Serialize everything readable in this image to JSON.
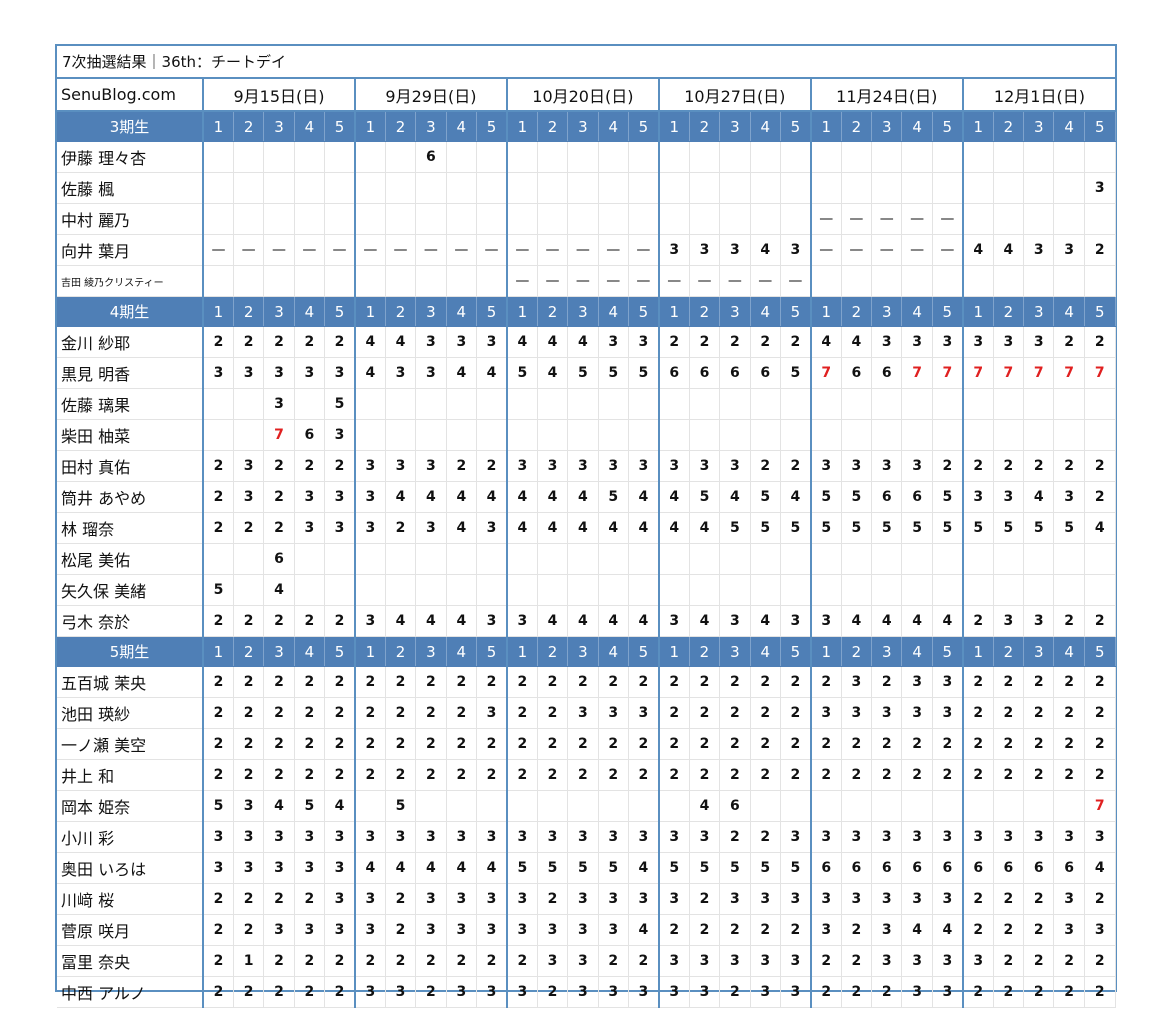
{
  "title": "7次抽選結果｜36th：チートデイ",
  "site_label": "SenuBlog.com",
  "dates": [
    "9月15日(日)",
    "9月29日(日)",
    "10月20日(日)",
    "10月27日(日)",
    "11月24日(日)",
    "12月1日(日)"
  ],
  "part_labels": [
    "1",
    "2",
    "3",
    "4",
    "5"
  ],
  "colors": {
    "header_blue": "#4f7fb6",
    "border_blue": "#5a8fc0",
    "highlight_red": "#e02020"
  },
  "groups": [
    {
      "name": "3期生",
      "members": [
        {
          "name": "伊藤 理々杏",
          "v": [
            "",
            "",
            "",
            "",
            "",
            "",
            "",
            "6",
            "",
            "",
            "",
            "",
            "",
            "",
            "",
            "",
            "",
            "",
            "",
            "",
            "",
            "",
            "",
            "",
            "",
            "",
            "",
            "",
            "",
            ""
          ]
        },
        {
          "name": "佐藤 楓",
          "v": [
            "",
            "",
            "",
            "",
            "",
            "",
            "",
            "",
            "",
            "",
            "",
            "",
            "",
            "",
            "",
            "",
            "",
            "",
            "",
            "",
            "",
            "",
            "",
            "",
            "",
            "",
            "",
            "",
            "",
            "3"
          ]
        },
        {
          "name": "中村 麗乃",
          "v": [
            "",
            "",
            "",
            "",
            "",
            "",
            "",
            "",
            "",
            "",
            "",
            "",
            "",
            "",
            "",
            "",
            "",
            "",
            "",
            "",
            "—",
            "—",
            "—",
            "—",
            "—",
            "",
            "",
            "",
            "",
            ""
          ]
        },
        {
          "name": "向井 葉月",
          "v": [
            "—",
            "—",
            "—",
            "—",
            "—",
            "—",
            "—",
            "—",
            "—",
            "—",
            "—",
            "—",
            "—",
            "—",
            "—",
            "3",
            "3",
            "3",
            "4",
            "3",
            "—",
            "—",
            "—",
            "—",
            "—",
            "4",
            "4",
            "3",
            "3",
            "2"
          ]
        },
        {
          "name": "吉田 綾乃クリスティー",
          "small": true,
          "v": [
            "",
            "",
            "",
            "",
            "",
            "",
            "",
            "",
            "",
            "",
            "—",
            "—",
            "—",
            "—",
            "—",
            "—",
            "—",
            "—",
            "—",
            "—",
            "",
            "",
            "",
            "",
            "",
            "",
            "",
            "",
            "",
            ""
          ]
        }
      ]
    },
    {
      "name": "4期生",
      "members": [
        {
          "name": "金川 紗耶",
          "v": [
            "2",
            "2",
            "2",
            "2",
            "2",
            "4",
            "4",
            "3",
            "3",
            "3",
            "4",
            "4",
            "4",
            "3",
            "3",
            "2",
            "2",
            "2",
            "2",
            "2",
            "4",
            "4",
            "3",
            "3",
            "3",
            "3",
            "3",
            "3",
            "2",
            "2"
          ]
        },
        {
          "name": "黒見 明香",
          "v": [
            "3",
            "3",
            "3",
            "3",
            "3",
            "4",
            "3",
            "3",
            "4",
            "4",
            "5",
            "4",
            "5",
            "5",
            "5",
            "6",
            "6",
            "6",
            "6",
            "5",
            "7r",
            "6",
            "6",
            "7r",
            "7r",
            "7r",
            "7r",
            "7r",
            "7r",
            "7r"
          ]
        },
        {
          "name": "佐藤 璃果",
          "v": [
            "",
            "",
            "3",
            "",
            "5",
            "",
            "",
            "",
            "",
            "",
            "",
            "",
            "",
            "",
            "",
            "",
            "",
            "",
            "",
            "",
            "",
            "",
            "",
            "",
            "",
            "",
            "",
            "",
            "",
            ""
          ]
        },
        {
          "name": "柴田 柚菜",
          "v": [
            "",
            "",
            "7r",
            "6",
            "3",
            "",
            "",
            "",
            "",
            "",
            "",
            "",
            "",
            "",
            "",
            "",
            "",
            "",
            "",
            "",
            "",
            "",
            "",
            "",
            "",
            "",
            "",
            "",
            "",
            ""
          ]
        },
        {
          "name": "田村 真佑",
          "v": [
            "2",
            "3",
            "2",
            "2",
            "2",
            "3",
            "3",
            "3",
            "2",
            "2",
            "3",
            "3",
            "3",
            "3",
            "3",
            "3",
            "3",
            "3",
            "2",
            "2",
            "3",
            "3",
            "3",
            "3",
            "2",
            "2",
            "2",
            "2",
            "2",
            "2"
          ]
        },
        {
          "name": "筒井 あやめ",
          "v": [
            "2",
            "3",
            "2",
            "3",
            "3",
            "3",
            "4",
            "4",
            "4",
            "4",
            "4",
            "4",
            "4",
            "5",
            "4",
            "4",
            "5",
            "4",
            "5",
            "4",
            "5",
            "5",
            "6",
            "6",
            "5",
            "3",
            "3",
            "4",
            "3",
            "2"
          ]
        },
        {
          "name": "林 瑠奈",
          "v": [
            "2",
            "2",
            "2",
            "3",
            "3",
            "3",
            "2",
            "3",
            "4",
            "3",
            "4",
            "4",
            "4",
            "4",
            "4",
            "4",
            "4",
            "5",
            "5",
            "5",
            "5",
            "5",
            "5",
            "5",
            "5",
            "5",
            "5",
            "5",
            "5",
            "4"
          ]
        },
        {
          "name": "松尾 美佑",
          "v": [
            "",
            "",
            "6",
            "",
            "",
            "",
            "",
            "",
            "",
            "",
            "",
            "",
            "",
            "",
            "",
            "",
            "",
            "",
            "",
            "",
            "",
            "",
            "",
            "",
            "",
            "",
            "",
            "",
            "",
            ""
          ]
        },
        {
          "name": "矢久保 美緒",
          "v": [
            "5",
            "",
            "4",
            "",
            "",
            "",
            "",
            "",
            "",
            "",
            "",
            "",
            "",
            "",
            "",
            "",
            "",
            "",
            "",
            "",
            "",
            "",
            "",
            "",
            "",
            "",
            "",
            "",
            "",
            ""
          ]
        },
        {
          "name": "弓木 奈於",
          "v": [
            "2",
            "2",
            "2",
            "2",
            "2",
            "3",
            "4",
            "4",
            "4",
            "3",
            "3",
            "4",
            "4",
            "4",
            "4",
            "3",
            "4",
            "3",
            "4",
            "3",
            "3",
            "4",
            "4",
            "4",
            "4",
            "2",
            "3",
            "3",
            "2",
            "2"
          ]
        }
      ]
    },
    {
      "name": "5期生",
      "members": [
        {
          "name": "五百城 茉央",
          "v": [
            "2",
            "2",
            "2",
            "2",
            "2",
            "2",
            "2",
            "2",
            "2",
            "2",
            "2",
            "2",
            "2",
            "2",
            "2",
            "2",
            "2",
            "2",
            "2",
            "2",
            "2",
            "3",
            "2",
            "3",
            "3",
            "2",
            "2",
            "2",
            "2",
            "2"
          ]
        },
        {
          "name": "池田 瑛紗",
          "v": [
            "2",
            "2",
            "2",
            "2",
            "2",
            "2",
            "2",
            "2",
            "2",
            "3",
            "2",
            "2",
            "3",
            "3",
            "3",
            "2",
            "2",
            "2",
            "2",
            "2",
            "3",
            "3",
            "3",
            "3",
            "3",
            "2",
            "2",
            "2",
            "2",
            "2"
          ]
        },
        {
          "name": "一ノ瀬 美空",
          "v": [
            "2",
            "2",
            "2",
            "2",
            "2",
            "2",
            "2",
            "2",
            "2",
            "2",
            "2",
            "2",
            "2",
            "2",
            "2",
            "2",
            "2",
            "2",
            "2",
            "2",
            "2",
            "2",
            "2",
            "2",
            "2",
            "2",
            "2",
            "2",
            "2",
            "2"
          ]
        },
        {
          "name": "井上 和",
          "v": [
            "2",
            "2",
            "2",
            "2",
            "2",
            "2",
            "2",
            "2",
            "2",
            "2",
            "2",
            "2",
            "2",
            "2",
            "2",
            "2",
            "2",
            "2",
            "2",
            "2",
            "2",
            "2",
            "2",
            "2",
            "2",
            "2",
            "2",
            "2",
            "2",
            "2"
          ]
        },
        {
          "name": "岡本 姫奈",
          "v": [
            "5",
            "3",
            "4",
            "5",
            "4",
            "",
            "5",
            "",
            "",
            "",
            "",
            "",
            "",
            "",
            "",
            "",
            "4",
            "6",
            "",
            "",
            "",
            "",
            "",
            "",
            "",
            "",
            "",
            "",
            "",
            "7r"
          ]
        },
        {
          "name": "小川 彩",
          "v": [
            "3",
            "3",
            "3",
            "3",
            "3",
            "3",
            "3",
            "3",
            "3",
            "3",
            "3",
            "3",
            "3",
            "3",
            "3",
            "3",
            "3",
            "2",
            "2",
            "3",
            "3",
            "3",
            "3",
            "3",
            "3",
            "3",
            "3",
            "3",
            "3",
            "3"
          ]
        },
        {
          "name": "奥田 いろは",
          "v": [
            "3",
            "3",
            "3",
            "3",
            "3",
            "4",
            "4",
            "4",
            "4",
            "4",
            "5",
            "5",
            "5",
            "5",
            "4",
            "5",
            "5",
            "5",
            "5",
            "5",
            "6",
            "6",
            "6",
            "6",
            "6",
            "6",
            "6",
            "6",
            "6",
            "4"
          ]
        },
        {
          "name": "川﨑 桜",
          "v": [
            "2",
            "2",
            "2",
            "2",
            "3",
            "3",
            "2",
            "3",
            "3",
            "3",
            "3",
            "2",
            "3",
            "3",
            "3",
            "3",
            "2",
            "3",
            "3",
            "3",
            "3",
            "3",
            "3",
            "3",
            "3",
            "2",
            "2",
            "2",
            "3",
            "2"
          ]
        },
        {
          "name": "菅原 咲月",
          "v": [
            "2",
            "2",
            "3",
            "3",
            "3",
            "3",
            "2",
            "3",
            "3",
            "3",
            "3",
            "3",
            "3",
            "3",
            "4",
            "2",
            "2",
            "2",
            "2",
            "2",
            "3",
            "2",
            "3",
            "4",
            "4",
            "2",
            "2",
            "2",
            "3",
            "3"
          ]
        },
        {
          "name": "冨里 奈央",
          "v": [
            "2",
            "1",
            "2",
            "2",
            "2",
            "2",
            "2",
            "2",
            "2",
            "2",
            "2",
            "3",
            "3",
            "2",
            "2",
            "3",
            "3",
            "3",
            "3",
            "3",
            "2",
            "2",
            "3",
            "3",
            "3",
            "3",
            "2",
            "2",
            "2",
            "2"
          ]
        },
        {
          "name": "中西 アルノ",
          "v": [
            "2",
            "2",
            "2",
            "2",
            "2",
            "3",
            "3",
            "2",
            "3",
            "3",
            "3",
            "2",
            "3",
            "3",
            "3",
            "3",
            "3",
            "2",
            "3",
            "3",
            "2",
            "2",
            "2",
            "3",
            "3",
            "2",
            "2",
            "2",
            "2",
            "2"
          ]
        }
      ]
    }
  ]
}
